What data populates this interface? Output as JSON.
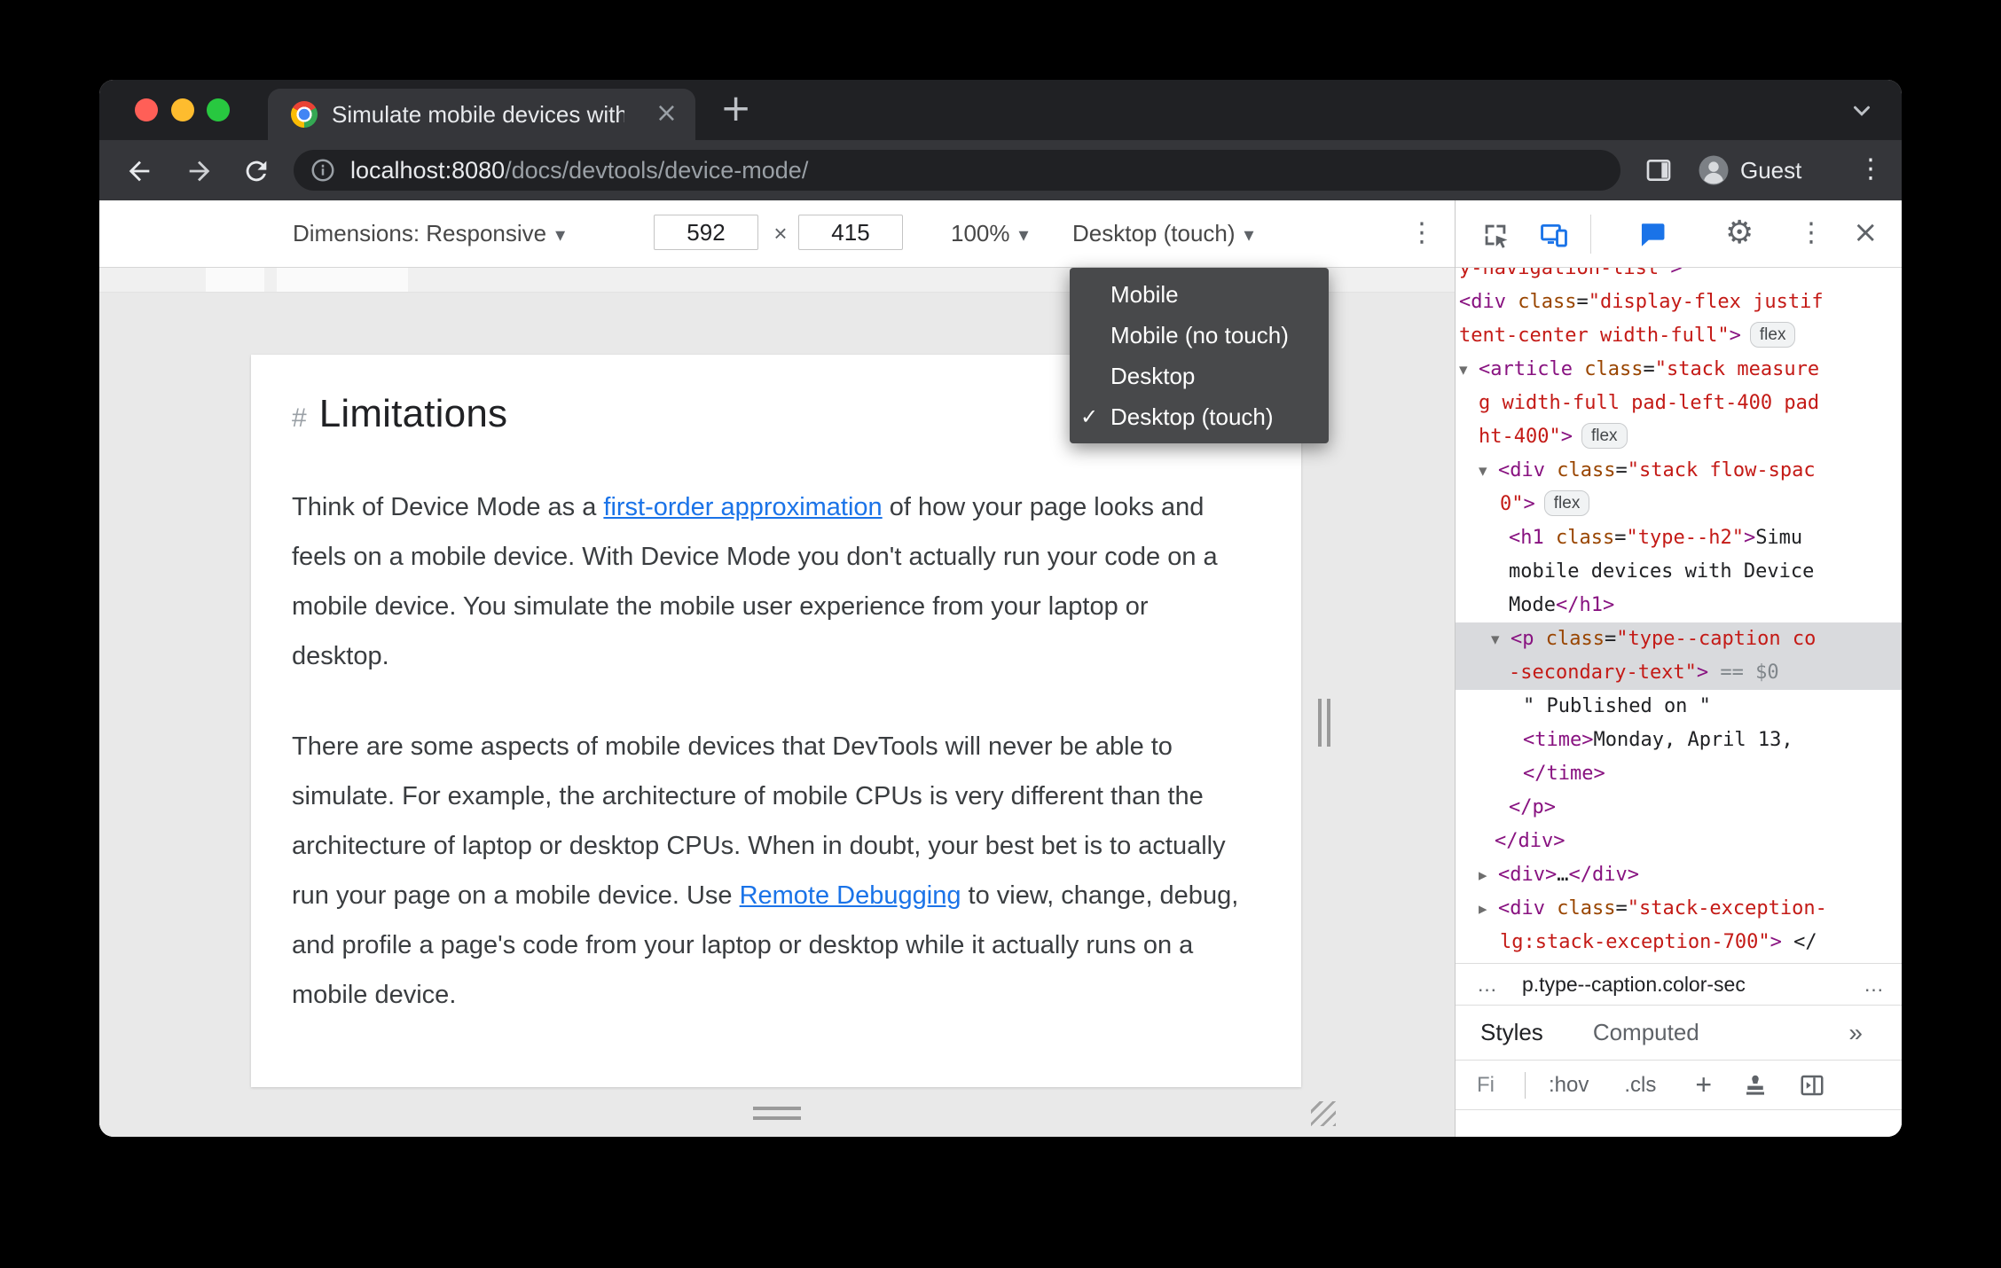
{
  "colors": {
    "accent": "#1a73e8",
    "link": "#1a73e8",
    "tag": "#881280",
    "attr": "#994500",
    "val": "#c41a16",
    "meta": "#80868b",
    "selection": "#d9dadd"
  },
  "browser": {
    "tab_title": "Simulate mobile devices with D",
    "tab_close": "×",
    "new_tab": "+",
    "url_host": "localhost:8080",
    "url_path": "/docs/devtools/device-mode/",
    "guest_label": "Guest",
    "menu_kebab": "⋮"
  },
  "device_toolbar": {
    "dimensions_label": "Dimensions: Responsive",
    "caret": "▾",
    "width_value": "592",
    "times": "×",
    "height_value": "415",
    "zoom_value": "100%",
    "device_type_value": "Desktop (touch)",
    "more_kebab": "⋮"
  },
  "dropdown": {
    "check_glyph": "✓",
    "items": [
      {
        "label": "Mobile",
        "checked": false
      },
      {
        "label": "Mobile (no touch)",
        "checked": false
      },
      {
        "label": "Desktop",
        "checked": false
      },
      {
        "label": "Desktop (touch)",
        "checked": true
      }
    ]
  },
  "page": {
    "heading_hash": "#",
    "heading": "Limitations",
    "para1_pre": "Think of Device Mode as a ",
    "para1_link": "first-order approximation",
    "para1_post": " of how your page looks and feels on a mobile device. With Device Mode you don't actually run your code on a mobile device. You simulate the mobile user experience from your laptop or desktop.",
    "para2_pre": "There are some aspects of mobile devices that DevTools will never be able to simulate. For example, the architecture of mobile CPUs is very different than the architecture of laptop or desktop CPUs. When in doubt, your best bet is to actually run your page on a mobile device. Use ",
    "para2_link": "Remote Debugging",
    "para2_post": " to view, change, debug, and profile a page's code from your laptop or desktop while it actually runs on a mobile device."
  },
  "devtools": {
    "gear": "⚙",
    "kebab": "⋮",
    "close": "×",
    "tree_lines": [
      {
        "pad": 4,
        "clip": "top",
        "segs": [
          {
            "c": "val",
            "t": "y-navigation-list\""
          },
          {
            "c": "tag",
            "t": ">"
          }
        ]
      },
      {
        "pad": 4,
        "segs": [
          {
            "c": "tag",
            "t": "<div"
          },
          {
            "c": "attr",
            "t": " class"
          },
          {
            "c": "punct",
            "t": "="
          },
          {
            "c": "val",
            "t": "\"display-flex justif"
          }
        ]
      },
      {
        "pad": 4,
        "badge": "flex",
        "segs": [
          {
            "c": "val",
            "t": "tent-center width-full\""
          },
          {
            "c": "tag",
            "t": ">"
          }
        ]
      },
      {
        "pad": 4,
        "arrow": "down",
        "segs": [
          {
            "c": "tag",
            "t": "<article"
          },
          {
            "c": "attr",
            "t": " class"
          },
          {
            "c": "punct",
            "t": "="
          },
          {
            "c": "val",
            "t": "\"stack measure"
          }
        ]
      },
      {
        "pad": 26,
        "segs": [
          {
            "c": "val",
            "t": "g width-full pad-left-400 pad"
          }
        ]
      },
      {
        "pad": 26,
        "badge": "flex",
        "segs": [
          {
            "c": "val",
            "t": "ht-400\""
          },
          {
            "c": "tag",
            "t": ">"
          }
        ]
      },
      {
        "pad": 26,
        "arrow": "down",
        "segs": [
          {
            "c": "tag",
            "t": "<div"
          },
          {
            "c": "attr",
            "t": " class"
          },
          {
            "c": "punct",
            "t": "="
          },
          {
            "c": "val",
            "t": "\"stack flow-spac"
          }
        ]
      },
      {
        "pad": 50,
        "badge": "flex",
        "segs": [
          {
            "c": "val",
            "t": "0\""
          },
          {
            "c": "tag",
            "t": ">"
          }
        ]
      },
      {
        "pad": 60,
        "segs": [
          {
            "c": "tag",
            "t": "<h1"
          },
          {
            "c": "attr",
            "t": " class"
          },
          {
            "c": "punct",
            "t": "="
          },
          {
            "c": "val",
            "t": "\"type--h2\""
          },
          {
            "c": "tag",
            "t": ">"
          },
          {
            "c": "txt",
            "t": "Simu"
          }
        ]
      },
      {
        "pad": 60,
        "segs": [
          {
            "c": "txt",
            "t": "mobile devices with Device"
          }
        ]
      },
      {
        "pad": 60,
        "segs": [
          {
            "c": "txt",
            "t": "Mode"
          },
          {
            "c": "tag",
            "t": "</h1>"
          }
        ]
      },
      {
        "pad": 40,
        "arrow": "down",
        "sel": true,
        "segs": [
          {
            "c": "tag",
            "t": "<p"
          },
          {
            "c": "attr",
            "t": " class"
          },
          {
            "c": "punct",
            "t": "="
          },
          {
            "c": "val",
            "t": "\"type--caption co"
          }
        ]
      },
      {
        "pad": 60,
        "sel": true,
        "segs": [
          {
            "c": "val",
            "t": "-secondary-text\""
          },
          {
            "c": "tag",
            "t": ">"
          },
          {
            "c": "meta",
            "t": " == $0"
          }
        ]
      },
      {
        "pad": 76,
        "segs": [
          {
            "c": "txt",
            "t": "\" Published on \""
          }
        ]
      },
      {
        "pad": 76,
        "segs": [
          {
            "c": "tag",
            "t": "<time>"
          },
          {
            "c": "txt",
            "t": "Monday, April 13,"
          }
        ]
      },
      {
        "pad": 76,
        "segs": [
          {
            "c": "tag",
            "t": "</time>"
          }
        ]
      },
      {
        "pad": 60,
        "segs": [
          {
            "c": "tag",
            "t": "</p>"
          }
        ]
      },
      {
        "pad": 44,
        "segs": [
          {
            "c": "tag",
            "t": "</div>"
          }
        ]
      },
      {
        "pad": 26,
        "arrow": "right",
        "segs": [
          {
            "c": "tag",
            "t": "<div>"
          },
          {
            "c": "txt",
            "t": "…"
          },
          {
            "c": "tag",
            "t": "</div>"
          }
        ]
      },
      {
        "pad": 26,
        "arrow": "right",
        "segs": [
          {
            "c": "tag",
            "t": "<div"
          },
          {
            "c": "attr",
            "t": " class"
          },
          {
            "c": "punct",
            "t": "="
          },
          {
            "c": "val",
            "t": "\"stack-exception-"
          }
        ]
      },
      {
        "pad": 50,
        "clip": "bottom",
        "segs": [
          {
            "c": "val",
            "t": "lg:stack-exception-700\""
          },
          {
            "c": "tag",
            "t": ">"
          },
          {
            "c": "txt",
            "t": " </"
          }
        ]
      }
    ],
    "breadcrumb": {
      "left_more": "…",
      "selected": "p.type--caption.color-sec",
      "right_more": "…"
    },
    "styles_tab": "Styles",
    "computed_tab": "Computed",
    "more_tabs": "»",
    "filter": {
      "text": "Fi",
      "hov": ":hov",
      "cls": ".cls",
      "plus": "+"
    }
  }
}
